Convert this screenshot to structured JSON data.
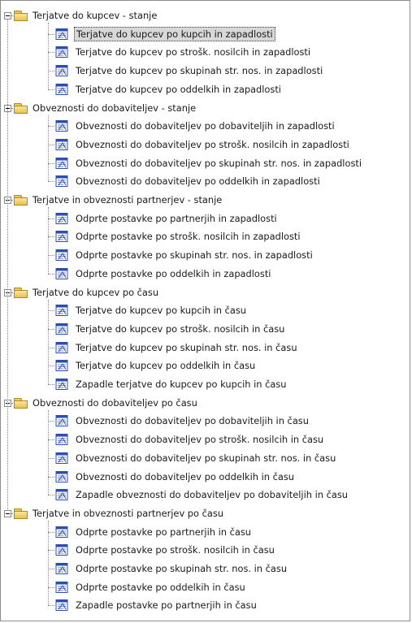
{
  "groups": [
    {
      "label": "Terjatve do kupcev - stanje",
      "items": [
        "Terjatve do kupcev po kupcih in zapadlosti",
        "Terjatve do kupcev po strošk. nosilcih in zapadlosti",
        "Terjatve do kupcev po skupinah str. nos. in zapadlosti",
        "Terjatve do kupcev po oddelkih in zapadlosti"
      ]
    },
    {
      "label": "Obveznosti do dobaviteljev - stanje",
      "items": [
        "Obveznosti do dobaviteljev po dobaviteljih in zapadlosti",
        "Obveznosti do dobaviteljev po strošk. nosilcih in zapadlosti",
        "Obveznosti do dobaviteljev po skupinah str. nos. in zapadlosti",
        "Obveznosti do dobaviteljev po oddelkih in zapadlosti"
      ]
    },
    {
      "label": "Terjatve in obveznosti partnerjev - stanje",
      "items": [
        "Odprte postavke po partnerjih in zapadlosti",
        "Odprte postavke po strošk. nosilcih in zapadlosti",
        "Odprte postavke po skupinah str. nos. in zapadlosti",
        "Odprte postavke po oddelkih in zapadlosti"
      ]
    },
    {
      "label": "Terjatve do kupcev po času",
      "items": [
        "Terjatve do kupcev po kupcih in času",
        "Terjatve do kupcev po strošk. nosilcih in času",
        "Terjatve do kupcev po skupinah str. nos. in času",
        "Terjatve do kupcev po oddelkih in času",
        "Zapadle terjatve do kupcev po kupcih in času"
      ]
    },
    {
      "label": "Obveznosti do dobaviteljev po času",
      "items": [
        "Obveznosti do dobaviteljev po dobaviteljih in času",
        "Obveznosti do dobaviteljev po strošk. nosilcih in času",
        "Obveznosti do dobaviteljev po skupinah str. nos. in času",
        "Obveznosti do dobaviteljev po oddelkih in času",
        "Zapadle obveznosti do dobaviteljev po dobaviteljih in času"
      ]
    },
    {
      "label": "Terjatve in obveznosti partnerjev po času",
      "items": [
        "Odprte postavke po partnerjih in času",
        "Odprte postavke po strošk. nosilcih in času",
        "Odprte postavke po skupinah str. nos. in času",
        "Odprte postavke po oddelkih in času",
        "Zapadle postavke po partnerjih in času"
      ]
    }
  ],
  "selected_item": "Terjatve do kupcev po kupcih in zapadlosti",
  "icons": {
    "group": "folder-icon",
    "report": "report-icon"
  },
  "colors": {
    "selection": "#d8d8d8",
    "folder": "#f0d270",
    "report_blue": "#2a4fb0"
  }
}
